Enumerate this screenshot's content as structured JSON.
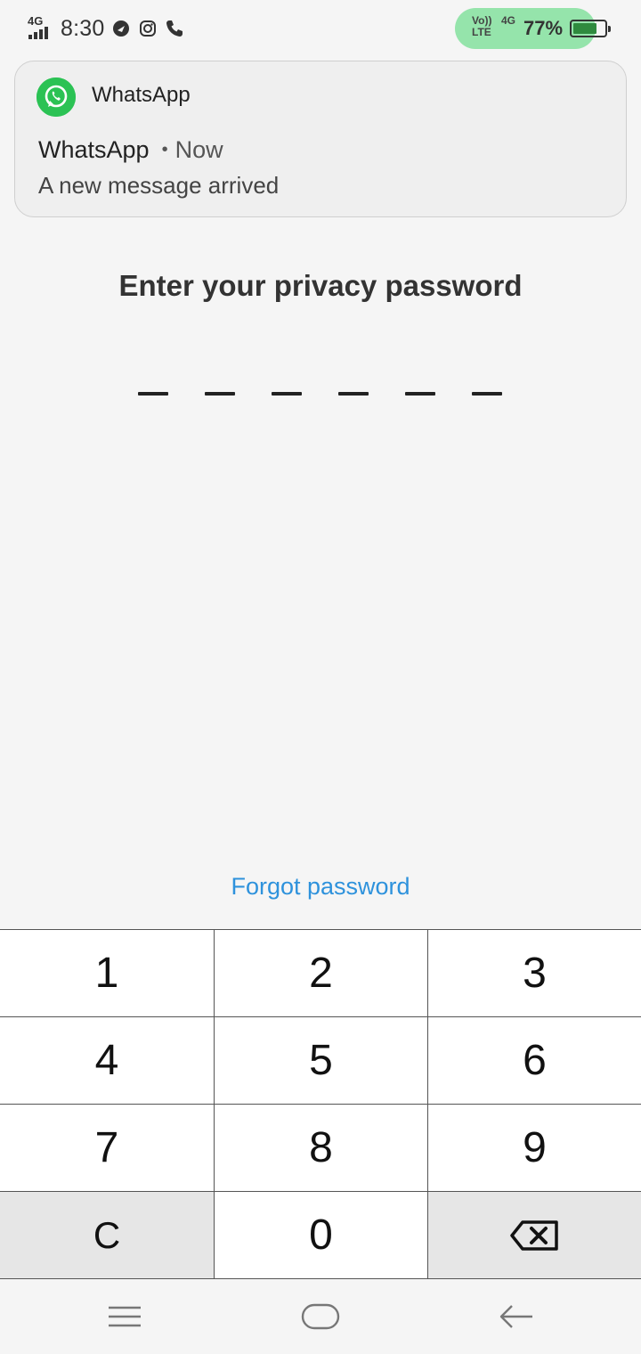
{
  "status_bar": {
    "network": "4G",
    "time": "8:30",
    "volte": "Vo))\nLTE",
    "network_right": "4G",
    "battery_percent": "77%",
    "battery_level": 0.77,
    "icons": [
      "signal-icon",
      "vpn-icon",
      "instagram-icon",
      "phone-icon",
      "battery-icon"
    ],
    "pill_color": "#8fe3a6"
  },
  "notification": {
    "app_name": "WhatsApp",
    "title": "WhatsApp",
    "time": "Now",
    "message": "A new message arrived",
    "icon": "whatsapp-icon",
    "icon_color": "#2bc254"
  },
  "lock": {
    "title": "Enter your privacy password",
    "pin_length": 6,
    "forgot_label": "Forgot password",
    "link_color": "#2e92dc"
  },
  "keypad": {
    "keys": [
      "1",
      "2",
      "3",
      "4",
      "5",
      "6",
      "7",
      "8",
      "9",
      "C",
      "0"
    ],
    "backspace_icon": "backspace-icon"
  },
  "nav_bar": {
    "icons": [
      "menu-icon",
      "home-icon",
      "back-icon"
    ]
  }
}
